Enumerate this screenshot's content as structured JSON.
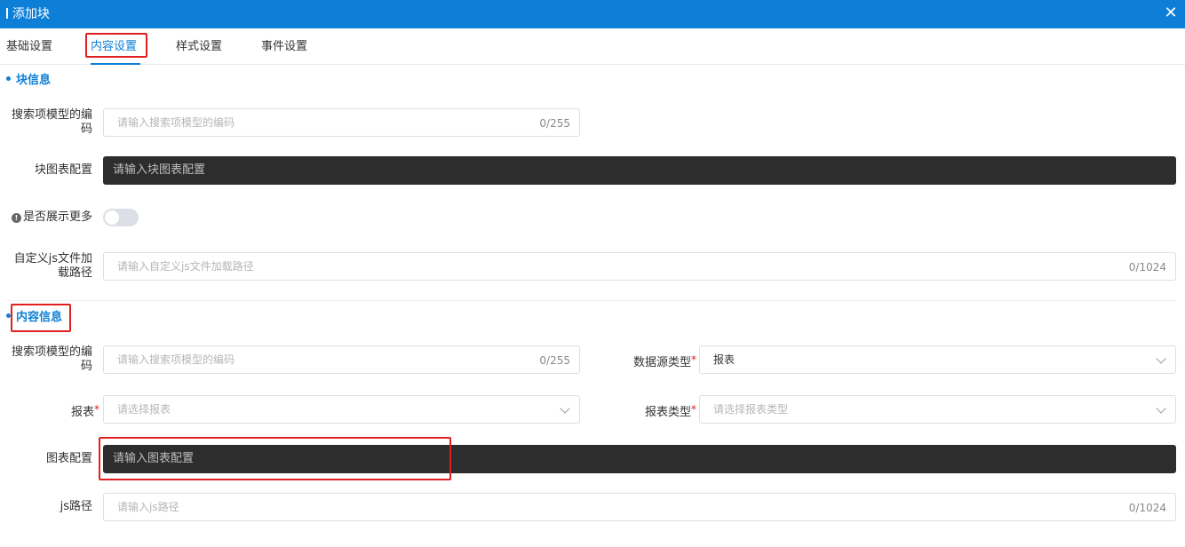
{
  "dialog": {
    "title": "添加块",
    "close_symbol": "✕"
  },
  "tabs": [
    {
      "label": "基础设置",
      "active": false
    },
    {
      "label": "内容设置",
      "active": true
    },
    {
      "label": "样式设置",
      "active": false
    },
    {
      "label": "事件设置",
      "active": false
    }
  ],
  "block_info": {
    "section_title": "块信息",
    "search_model_code": {
      "label_line1": "搜索项模型的编",
      "label_line2": "码",
      "placeholder": "请输入搜索项模型的编码",
      "value": "",
      "counter": "0/255"
    },
    "block_chart_config": {
      "label": "块图表配置",
      "placeholder": "请输入块图表配置",
      "value": ""
    },
    "show_more": {
      "label": "是否展示更多",
      "enabled": false,
      "info_icon": "info-icon"
    },
    "custom_js_path": {
      "label_line1": "自定义js文件加",
      "label_line2": "载路径",
      "placeholder": "请输入自定义js文件加载路径",
      "value": "",
      "counter": "0/1024"
    }
  },
  "content_info": {
    "section_title": "内容信息",
    "search_model_code": {
      "label_line1": "搜索项模型的编",
      "label_line2": "码",
      "placeholder": "请输入搜索项模型的编码",
      "value": "",
      "counter": "0/255"
    },
    "datasource_type": {
      "label": "数据源类型",
      "required": "*",
      "value": "报表"
    },
    "report": {
      "label": "报表",
      "required": "*",
      "placeholder": "请选择报表",
      "value": ""
    },
    "report_type": {
      "label": "报表类型",
      "required": "*",
      "placeholder": "请选择报表类型",
      "value": ""
    },
    "chart_config": {
      "label": "图表配置",
      "placeholder": "请输入图表配置",
      "value": ""
    },
    "js_path": {
      "label": "js路径",
      "placeholder": "请输入js路径",
      "value": "",
      "counter": "0/1024"
    }
  },
  "colors": {
    "accent": "#0d7fd6",
    "highlight": "#e02020",
    "editor_bg": "#2d2d2d"
  }
}
